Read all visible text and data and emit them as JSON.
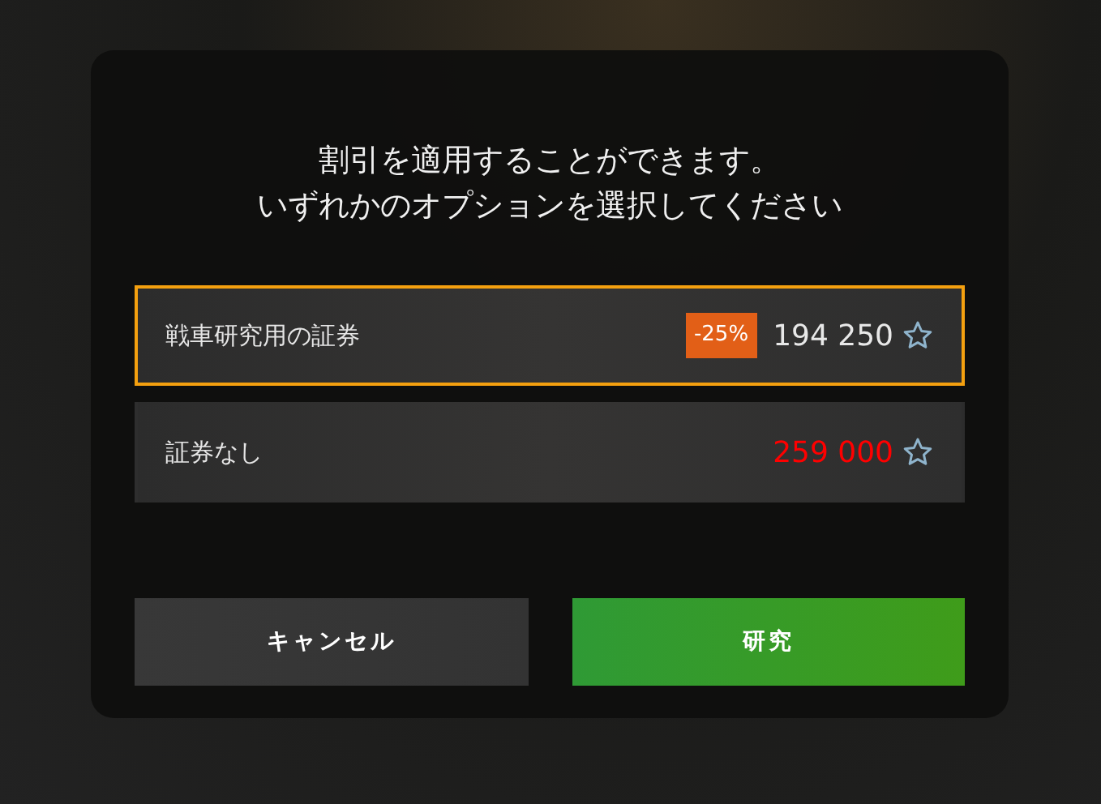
{
  "dialog": {
    "title_lines": [
      "割引を適用することができます。",
      "いずれかのオプションを選択してください"
    ],
    "options": [
      {
        "label": "戦車研究用の証券",
        "selected": true,
        "discount": "-25%",
        "price": "194 250",
        "color": "#e8e8e8"
      },
      {
        "label": "証券なし",
        "selected": false,
        "price": "259 000",
        "color": "#ff0000"
      }
    ],
    "buttons": [
      {
        "label": "キャンセル",
        "kind": "secondary"
      },
      {
        "label": "研究",
        "kind": "primary"
      }
    ]
  }
}
